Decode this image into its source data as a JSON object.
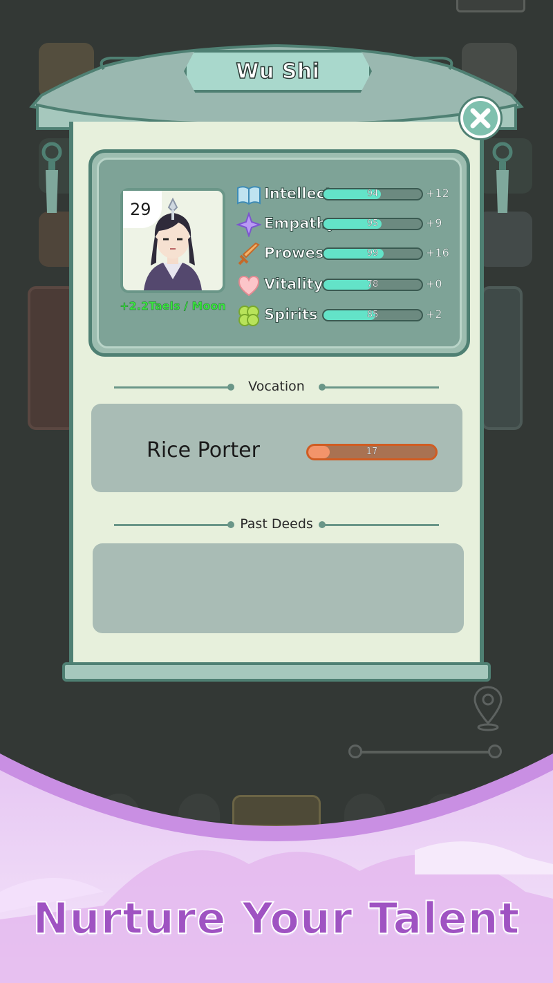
{
  "dialog": {
    "title": "Wu Shi",
    "close_label": "✕"
  },
  "character": {
    "age": "29",
    "income": "+2.2Taels / Moon"
  },
  "stats": [
    {
      "name": "Intellect",
      "value": 94,
      "display": "94",
      "bonus": "+12",
      "icon": "book-icon"
    },
    {
      "name": "Empathy",
      "value": 95,
      "display": "95",
      "bonus": "+9",
      "icon": "sparkle-icon"
    },
    {
      "name": "Prowess",
      "value": 99,
      "display": "99",
      "bonus": "+16",
      "icon": "sword-icon"
    },
    {
      "name": "Vitality",
      "value": 78,
      "display": "78",
      "bonus": "+0",
      "icon": "heart-icon"
    },
    {
      "name": "Spirits",
      "value": 85,
      "display": "85",
      "bonus": "+2",
      "icon": "clover-icon"
    }
  ],
  "stat_max": 100,
  "sections": {
    "vocation": "Vocation",
    "past_deeds": "Past Deeds"
  },
  "vocation": {
    "name": "Rice Porter",
    "progress_display": "17",
    "progress_fraction": 0.17
  },
  "promo": {
    "headline": "Nurture Your Talent"
  },
  "colors": {
    "accent": "#4f8073",
    "panel": "#e7f0dc",
    "stat_fill": "#63e3c8",
    "vocation_fill": "#f3946a",
    "promo_text": "#9f53c2",
    "income_text": "#39e63d"
  }
}
